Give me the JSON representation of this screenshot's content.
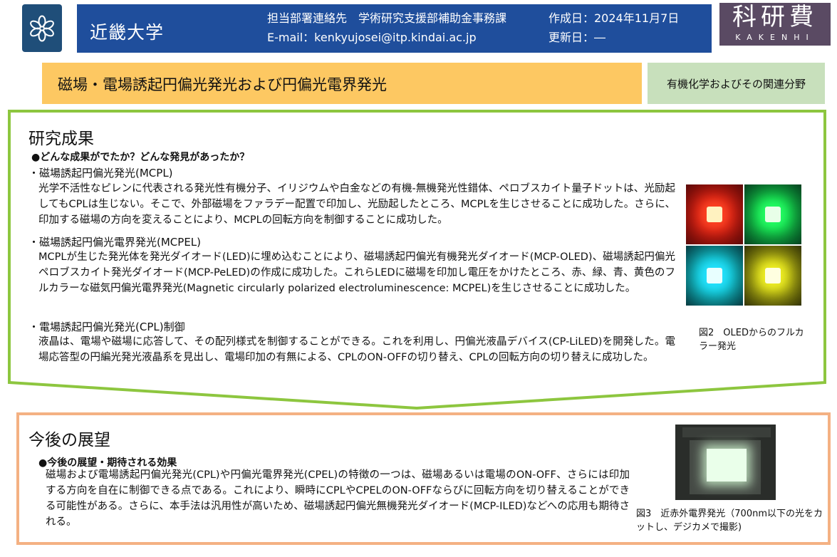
{
  "header": {
    "university": "近畿大学",
    "contact_dept": "担当部署連絡先　学術研究支援部補助金事務課",
    "contact_email": "E-mail：kenkyujosei@itp.kindai.ac.jp",
    "created": "作成日：2024年11月7日",
    "updated": "更新日：―",
    "kaken_main": "科研費",
    "kaken_sub": "KAKENHI"
  },
  "title": "磁場・電場誘起円偏光発光および円偏光電界発光",
  "field": "有機化学およびその関連分野",
  "results": {
    "heading": "研究成果",
    "question": "●どんな成果がでたか？どんな発見があったか？",
    "items": [
      {
        "title": "・磁場誘起円偏光発光(MCPL)",
        "body": "光学不活性なピレンに代表される発光性有機分子、イリジウムや白金などの有機-無機発光性錯体、ペロブスカイト量子ドットは、光励起してもCPLは生じない。そこで、外部磁場をファラデー配置で印加し、光励起したところ、MCPLを生じさせることに成功した。さらに、印加する磁場の方向を変えることにより、MCPLの回転方向を制御することに成功した。"
      },
      {
        "title": "・磁場誘起円偏光電界発光(MCPEL)",
        "body": "MCPLが生じた発光体を発光ダイオード(LED)に埋め込むことにより、磁場誘起円偏光有機発光ダイオード(MCP-OLED)、磁場誘起円偏光ペロブスカイト発光ダイオード(MCP-PeLED)の作成に成功した。これらLEDに磁場を印加し電圧をかけたところ、赤、緑、青、黄色のフルカラーな磁気円偏光電界発光(Magnetic circularly polarized electroluminescence: MCPEL)を生じさせることに成功した。"
      },
      {
        "title": "・電場誘起円偏光発光(CPL)制御",
        "body": "液晶は、電場や磁場に応答して、その配列様式を制御することができる。これを利用し、円偏光液晶デバイス(CP-LiLED)を開発した。電場応答型の円編光発光液晶系を見出し、電場印加の有無による、CPLのON-OFFの切り替え、CPLの回転方向の切り替えに成功した。"
      }
    ],
    "fig2_caption": "図2　OLEDからのフルカラー発光"
  },
  "outlook": {
    "heading": "今後の展望",
    "question": "●今後の展望・期待される効果",
    "body": "磁場および電場誘起円偏光発光(CPL)や円偏光電界発光(CPEL)の特徴の一つは、磁場あるいは電場のON-OFF、さらには印加する方向を自在に制御できる点である。これにより、瞬時にCPLやCPELのON-OFFならびに回転方向を切り替えることができる可能性がある。さらに、本手法は汎用性が高いため、磁場誘起円偏光無機発光ダイオード(MCP-ILED)などへの応用も期待される。",
    "fig3_caption": "図3　近赤外電界発光（700nm以下の光をカットし、デジカメで撮影)"
  },
  "colors": {
    "header_blue": "#1f4e9c",
    "title_orange": "#fdc862",
    "field_green": "#c8e0bc",
    "results_border": "#8dc63f",
    "outlook_border": "#f4b183"
  }
}
